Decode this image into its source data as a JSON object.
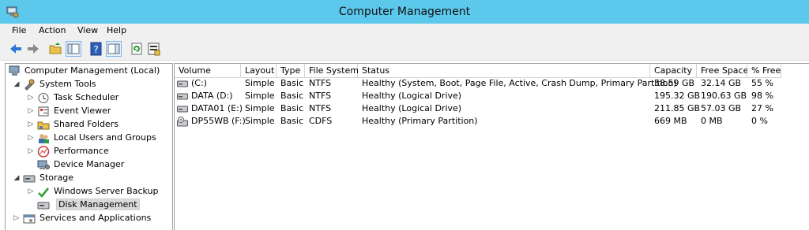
{
  "window": {
    "title": "Computer Management"
  },
  "menubar": {
    "items": [
      "File",
      "Action",
      "View",
      "Help"
    ]
  },
  "toolbar": {
    "buttons": [
      "back-icon",
      "forward-icon",
      "up-folder-icon",
      "show-hide-tree-icon",
      "help-icon",
      "properties-icon",
      "refresh-icon",
      "export-list-icon"
    ]
  },
  "tree": {
    "root": "Computer Management (Local)",
    "system_tools": "System Tools",
    "task_scheduler": "Task Scheduler",
    "event_viewer": "Event Viewer",
    "shared_folders": "Shared Folders",
    "local_users": "Local Users and Groups",
    "performance": "Performance",
    "device_manager": "Device Manager",
    "storage": "Storage",
    "wsb": "Windows Server Backup",
    "disk_management": "Disk Management",
    "services": "Services and Applications"
  },
  "table": {
    "headers": [
      "Volume",
      "Layout",
      "Type",
      "File System",
      "Status",
      "Capacity",
      "Free Space",
      "% Free"
    ],
    "rows": [
      {
        "volume": "(C:)",
        "layout": "Simple",
        "type": "Basic",
        "fs": "NTFS",
        "status": "Healthy (System, Boot, Page File, Active, Crash Dump, Primary Partition)",
        "capacity": "58.59 GB",
        "free": "32.14 GB",
        "pct": "55 %"
      },
      {
        "volume": "DATA (D:)",
        "layout": "Simple",
        "type": "Basic",
        "fs": "NTFS",
        "status": "Healthy (Logical Drive)",
        "capacity": "195.32 GB",
        "free": "190.63 GB",
        "pct": "98 %"
      },
      {
        "volume": "DATA01 (E:)",
        "layout": "Simple",
        "type": "Basic",
        "fs": "NTFS",
        "status": "Healthy (Logical Drive)",
        "capacity": "211.85 GB",
        "free": "57.03 GB",
        "pct": "27 %"
      },
      {
        "volume": "DP55WB (F:)",
        "layout": "Simple",
        "type": "Basic",
        "fs": "CDFS",
        "status": "Healthy (Primary Partition)",
        "capacity": "669 MB",
        "free": "0 MB",
        "pct": "0 %"
      }
    ]
  },
  "colors": {
    "titlebar": "#5cc8ec",
    "selection": "#dadada"
  }
}
